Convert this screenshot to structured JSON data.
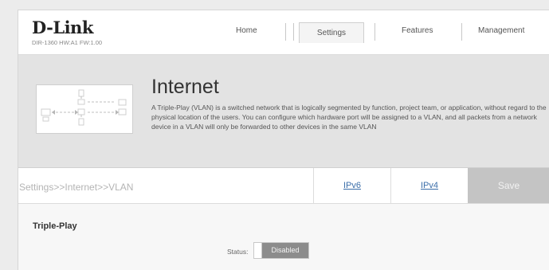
{
  "header": {
    "brand": "D-Link",
    "model": "DIR-1360 HW:A1 FW:1.00"
  },
  "nav": {
    "home": "Home",
    "settings": "Settings",
    "features": "Features",
    "management": "Management",
    "active": "Settings"
  },
  "banner": {
    "title": "Internet",
    "description": "A Triple-Play (VLAN) is a switched network that is logically segmented by function, project team, or application, without regard to the physical location of the users. You can configure which hardware port will be assigned to a VLAN, and all packets from a network device in a VLAN will only be forwarded to other devices in the same VLAN"
  },
  "toolbar": {
    "breadcrumb": "Settings>>Internet>>VLAN",
    "ipv6_label": "IPv6",
    "ipv4_label": "IPv4",
    "save_label": "Save"
  },
  "section": {
    "title": "Triple-Play",
    "status_label": "Status:",
    "status_value": "Disabled"
  },
  "icons": {
    "illustration": "network-topology-icon"
  },
  "colors": {
    "link": "#3b6ea9",
    "save_disabled": "#c4c4c4",
    "toggle_off": "#8c8c8c"
  }
}
